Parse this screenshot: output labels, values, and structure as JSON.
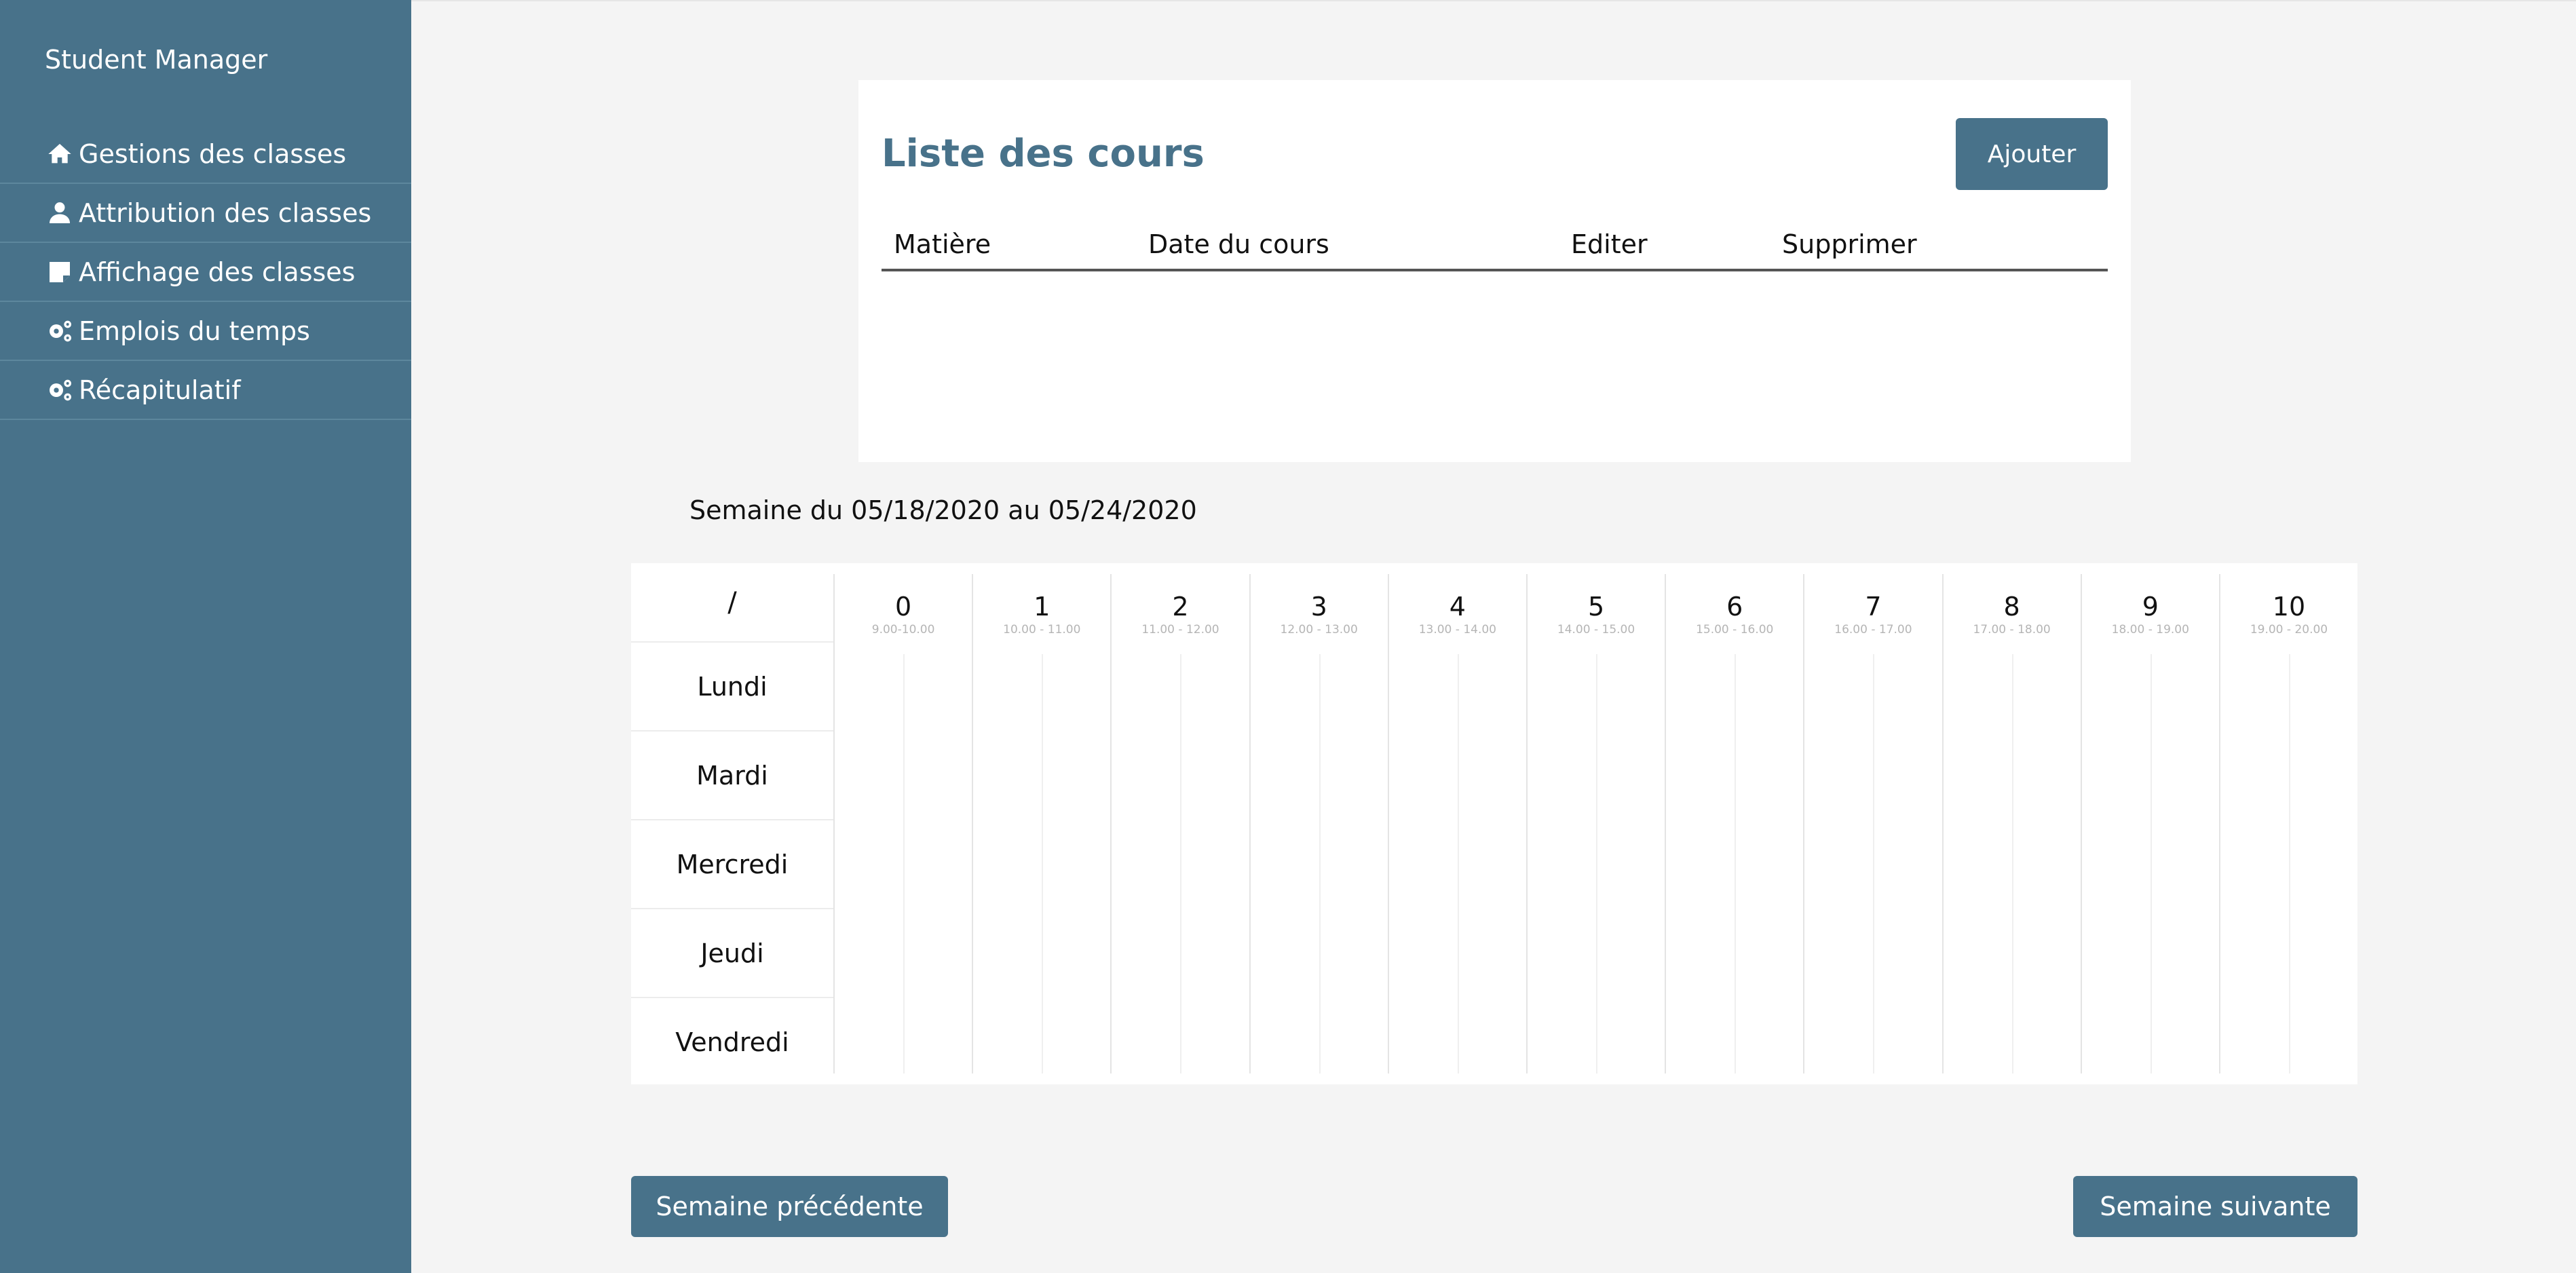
{
  "app": {
    "title": "Student Manager"
  },
  "sidebar": {
    "items": [
      {
        "label": "Gestions des classes",
        "icon": "home-icon"
      },
      {
        "label": "Attribution des classes",
        "icon": "user-icon"
      },
      {
        "label": "Affichage des classes",
        "icon": "note-icon"
      },
      {
        "label": "Emplois du temps",
        "icon": "gears-icon"
      },
      {
        "label": "Récapitulatif",
        "icon": "gears-icon"
      }
    ]
  },
  "courses": {
    "title": "Liste des cours",
    "add_label": "Ajouter",
    "columns": [
      "Matière",
      "Date du cours",
      "Editer",
      "Supprimer"
    ],
    "rows": []
  },
  "week": {
    "label": "Semaine du 05/18/2020 au 05/24/2020"
  },
  "timetable": {
    "corner": "/",
    "days": [
      "Lundi",
      "Mardi",
      "Mercredi",
      "Jeudi",
      "Vendredi"
    ],
    "slots": [
      {
        "num": "0",
        "range": "9.00-10.00"
      },
      {
        "num": "1",
        "range": "10.00 - 11.00"
      },
      {
        "num": "2",
        "range": "11.00 - 12.00"
      },
      {
        "num": "3",
        "range": "12.00 - 13.00"
      },
      {
        "num": "4",
        "range": "13.00 - 14.00"
      },
      {
        "num": "5",
        "range": "14.00 - 15.00"
      },
      {
        "num": "6",
        "range": "15.00 - 16.00"
      },
      {
        "num": "7",
        "range": "16.00 - 17.00"
      },
      {
        "num": "8",
        "range": "17.00 - 18.00"
      },
      {
        "num": "9",
        "range": "18.00 - 19.00"
      },
      {
        "num": "10",
        "range": "19.00 - 20.00"
      }
    ]
  },
  "nav_buttons": {
    "prev": "Semaine précédente",
    "next": "Semaine suivante"
  },
  "colors": {
    "accent": "#48728a",
    "background": "#f4f4f4"
  }
}
